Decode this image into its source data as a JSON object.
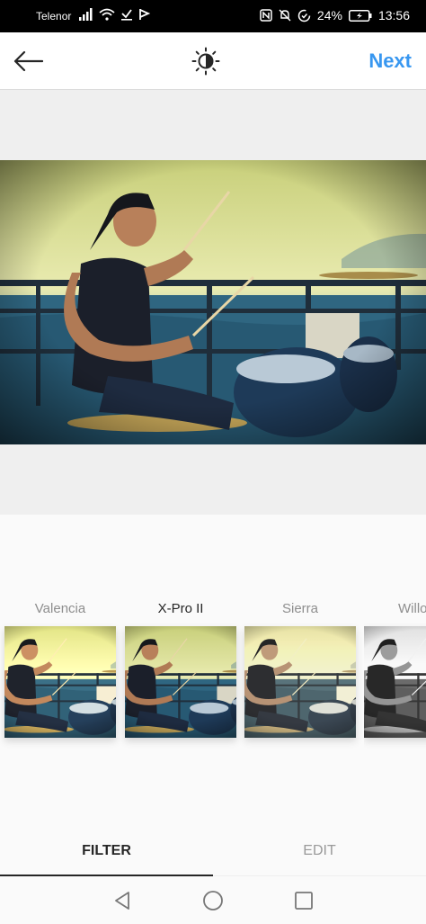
{
  "status_bar": {
    "carrier": "Telenor",
    "battery": "24%",
    "time": "13:56",
    "icons": [
      "signal-icon",
      "wifi-icon",
      "download-icon",
      "flag-icon",
      "nfc-icon",
      "mute-icon",
      "data-saver-icon",
      "battery-icon"
    ]
  },
  "header": {
    "back_icon": "arrow-left-icon",
    "lux_icon": "brightness-icon",
    "next_label": "Next"
  },
  "filters": {
    "items": [
      {
        "label": "Valencia",
        "selected": false
      },
      {
        "label": "X-Pro II",
        "selected": true
      },
      {
        "label": "Sierra",
        "selected": false
      },
      {
        "label": "Willow",
        "selected": false
      }
    ]
  },
  "tabs": {
    "filter_label": "FILTER",
    "edit_label": "EDIT",
    "active": "FILTER"
  },
  "nav": {
    "back_icon": "triangle-back-icon",
    "home_icon": "circle-home-icon",
    "recents_icon": "square-recents-icon"
  },
  "colors": {
    "accent": "#3897f0",
    "text_dark": "#262626",
    "text_muted": "#8e8e8e"
  }
}
